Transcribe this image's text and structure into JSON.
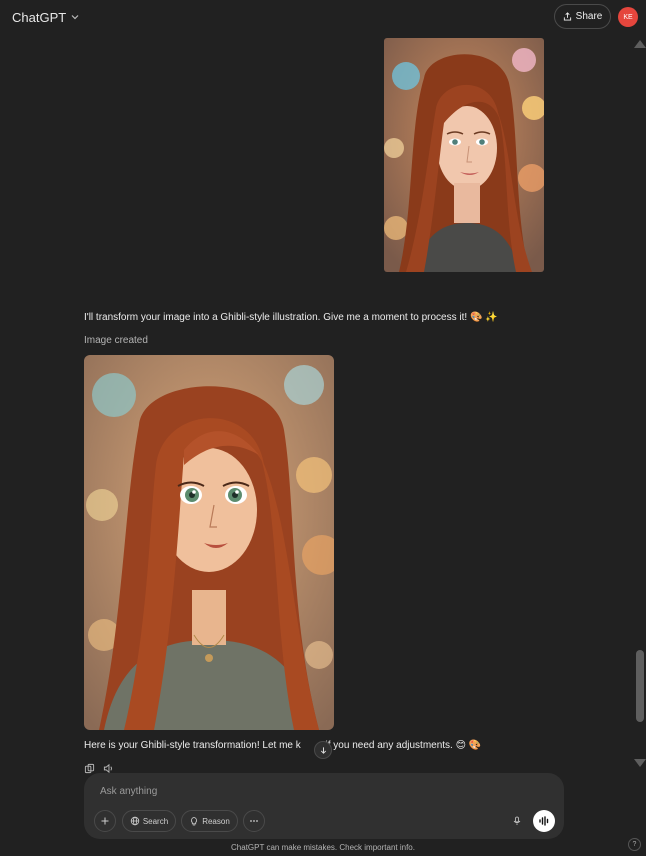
{
  "header": {
    "model_label": "ChatGPT",
    "share_label": "Share",
    "avatar_initials": "KE"
  },
  "conversation": {
    "assistant_message_1": "I'll transform your image into a Ghibli-style illustration. Give me a moment to process it! 🎨 ✨",
    "image_status": "Image created",
    "assistant_message_2_before": "Here is your Ghibli-style transformation! Let me k",
    "assistant_message_2_after": " if you need any adjustments. 😊 🎨"
  },
  "composer": {
    "placeholder": "Ask anything",
    "search_label": "Search",
    "reason_label": "Reason"
  },
  "footer": {
    "disclaimer": "ChatGPT can make mistakes. Check important info.",
    "help_label": "?"
  },
  "colors": {
    "background": "#212121",
    "composer": "#303030",
    "avatar": "#e5463d"
  }
}
